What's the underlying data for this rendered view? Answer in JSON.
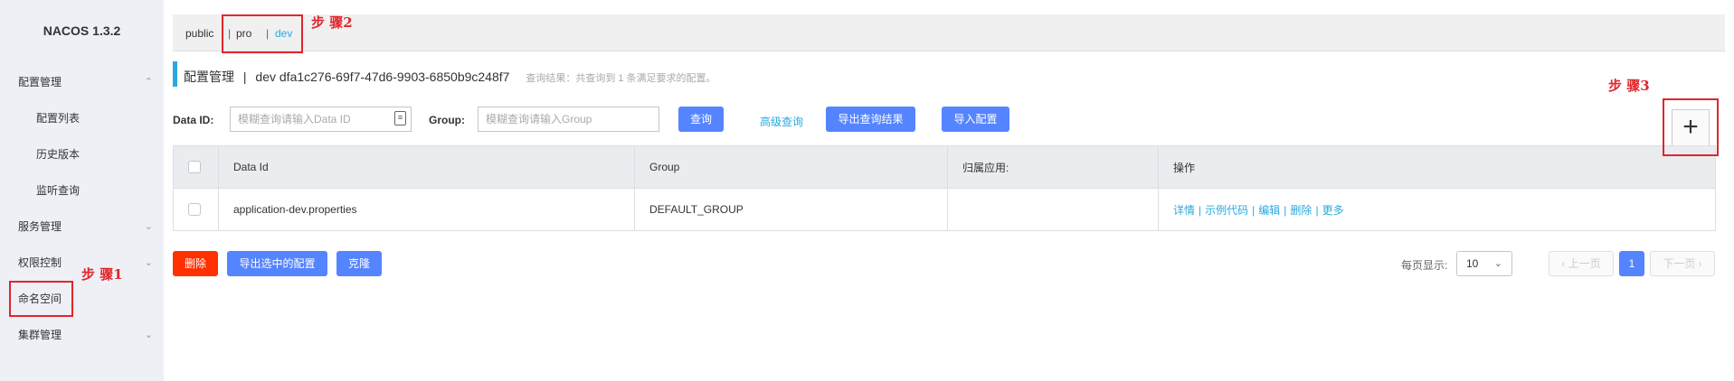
{
  "sidebar": {
    "brand": "NACOS 1.3.2",
    "items": [
      {
        "label": "配置管理",
        "chev": "^"
      },
      {
        "label": "配置列表"
      },
      {
        "label": "历史版本"
      },
      {
        "label": "监听查询"
      },
      {
        "label": "服务管理",
        "chev": "v"
      },
      {
        "label": "权限控制",
        "chev": "v"
      },
      {
        "label": "命名空间"
      },
      {
        "label": "集群管理",
        "chev": "v"
      }
    ]
  },
  "namespace_tabs": {
    "public": "public",
    "pro": "pro",
    "dev": "dev",
    "sep": "|"
  },
  "title": {
    "section": "配置管理",
    "sep": "|",
    "namespace": "dev",
    "namespace_id": "dfa1c276-69f7-47d6-9903-6850b9c248f7",
    "result": "查询结果：共查询到 1 条满足要求的配置。"
  },
  "search": {
    "data_id_label": "Data ID:",
    "data_id_placeholder": "模糊查询请输入Data ID",
    "group_label": "Group:",
    "group_placeholder": "模糊查询请输入Group",
    "query_btn": "查询",
    "advanced_link": "高级查询",
    "export_btn": "导出查询结果",
    "import_btn": "导入配置"
  },
  "plus_label": "+",
  "table": {
    "headers": [
      "Data Id",
      "Group",
      "归属应用:",
      "操作"
    ],
    "rows": [
      {
        "data_id": "application-dev.properties",
        "group": "DEFAULT_GROUP",
        "app": "",
        "ops": [
          "详情",
          "示例代码",
          "编辑",
          "删除",
          "更多"
        ]
      }
    ]
  },
  "bottom": {
    "delete_btn": "删除",
    "export_selected_btn": "导出选中的配置",
    "clone_btn": "克隆",
    "page_size_label": "每页显示:",
    "page_size": "10",
    "prev": "上一页",
    "current_page": "1",
    "next": "下一页"
  },
  "annotations": {
    "step1": "步 骤1",
    "step2": "步 骤2",
    "step3": "步 骤3"
  }
}
